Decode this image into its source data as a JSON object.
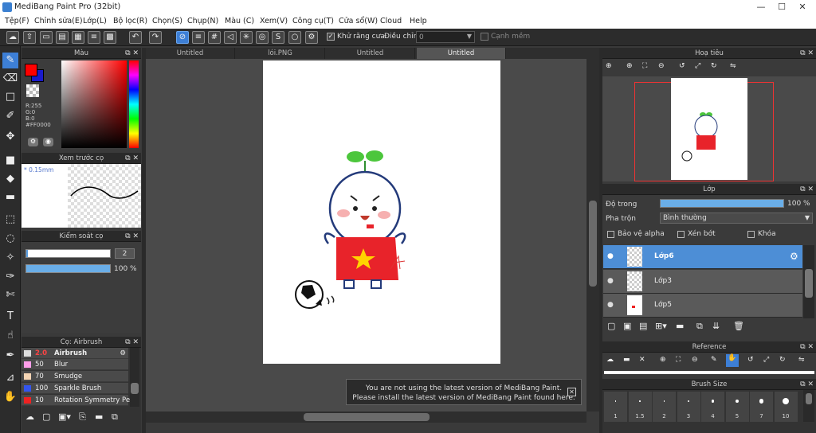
{
  "app": {
    "title": "MediBang Paint Pro (32bit)"
  },
  "menu": [
    "Tệp(F)",
    "Chỉnh sửa(E)",
    "Lớp(L)",
    "Bộ lọc(R)",
    "Chọn(S)",
    "Chụp(N)",
    "Màu (C)",
    "Xem(V)",
    "Công cụ(T)",
    "Cửa sổ(W)",
    "Cloud",
    "Help"
  ],
  "toolbar": {
    "antialias_label": "Khử răng cưa",
    "adjust_label": "Điều chỉnh",
    "adjust_value": "0",
    "snap_label": "Cạnh mềm"
  },
  "color_panel": {
    "title": "Màu",
    "r": "R:255",
    "g": "G:0",
    "b": "B:0",
    "hex": "#FF0000",
    "primary": "#ff0000",
    "secondary": "#1a1acc"
  },
  "preview_panel": {
    "title": "Xem trước cọ",
    "size": "* 0.15mm"
  },
  "brush_control": {
    "title": "Kiểm soát cọ",
    "size_value": "2",
    "opacity_value": "100 %"
  },
  "brush_panel": {
    "title": "Cọ: Airbrush",
    "items": [
      {
        "size": "2.0",
        "name": "Airbrush",
        "color": "#dddddd"
      },
      {
        "size": "50",
        "name": "Blur",
        "color": "#ff9eea"
      },
      {
        "size": "70",
        "name": "Smudge",
        "color": "#f5d5b5"
      },
      {
        "size": "100",
        "name": "Sparkle Brush",
        "color": "#3355ee"
      },
      {
        "size": "10",
        "name": "Rotation Symmetry Pe",
        "color": "#ee2222"
      }
    ]
  },
  "tabs": [
    "Untitled",
    "lói.PNG",
    "Untitled",
    "Untitled"
  ],
  "navigator": {
    "title": "Hoạ tiêu"
  },
  "layer_panel": {
    "title": "Lớp",
    "opacity_label": "Độ trong",
    "opacity_value": "100 %",
    "opacity_fraction": 1.0,
    "blend_label": "Pha trộn",
    "blend_value": "Bình thường",
    "protect_alpha": "Bảo vệ alpha",
    "clipping": "Xén bớt",
    "lock": "Khóa",
    "layers": [
      "Lớp6",
      "Lớp3",
      "Lớp5"
    ]
  },
  "reference": {
    "title": "Reference"
  },
  "brush_size": {
    "title": "Brush Size",
    "sizes": [
      "1",
      "1.5",
      "2",
      "3",
      "4",
      "5",
      "7",
      "10"
    ]
  },
  "notice": {
    "line1": "You are not using the latest version of MediBang Paint.",
    "line2": "Please install the latest version of MediBang Paint found here."
  }
}
